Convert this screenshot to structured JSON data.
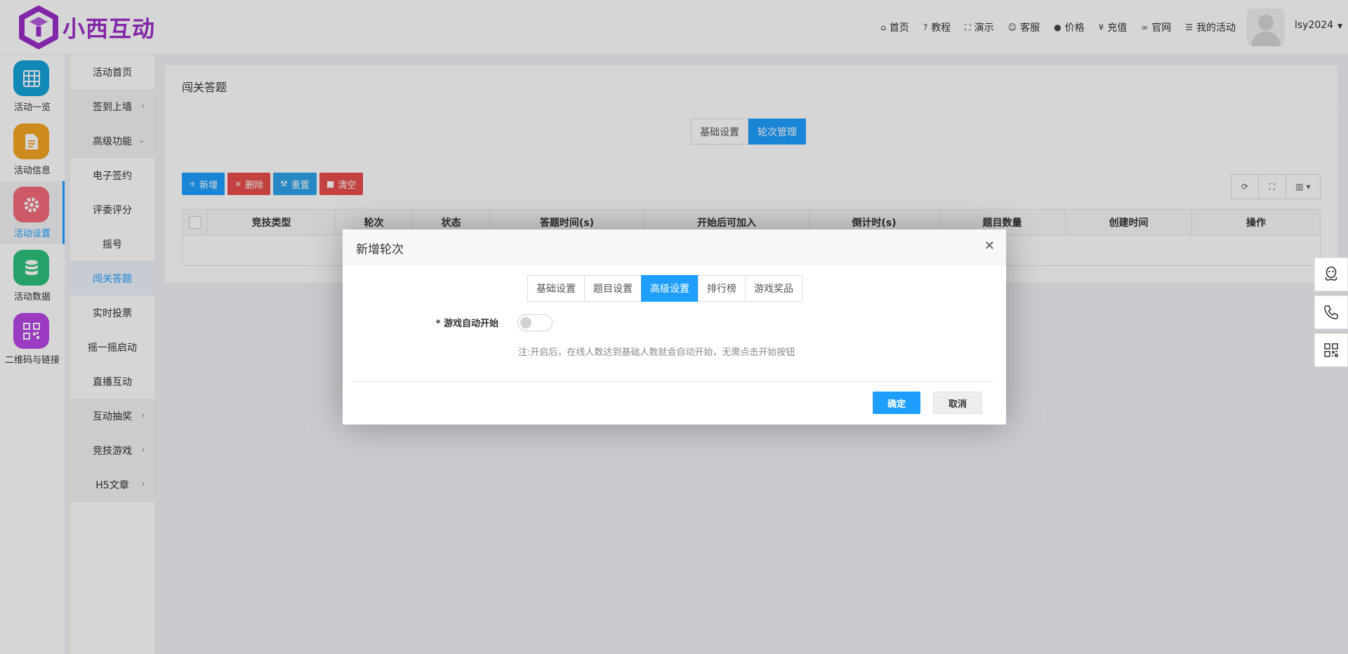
{
  "brand": {
    "name": "小西互动",
    "color": "#9b2ec9"
  },
  "topnav": [
    {
      "label": "首页",
      "icon": "home-icon"
    },
    {
      "label": "教程",
      "icon": "question-icon"
    },
    {
      "label": "演示",
      "icon": "expand-icon"
    },
    {
      "label": "客服",
      "icon": "smile-icon"
    },
    {
      "label": "价格",
      "icon": "info-icon"
    },
    {
      "label": "充值",
      "icon": "yen-icon"
    },
    {
      "label": "官网",
      "icon": "link-icon"
    },
    {
      "label": "我的活动",
      "icon": "list-icon"
    }
  ],
  "user": {
    "name": "lsy2024"
  },
  "rail": [
    {
      "label": "活动一览",
      "icon": "grid-icon",
      "color": "#16a3d9"
    },
    {
      "label": "活动信息",
      "icon": "document-icon",
      "color": "#f5a623"
    },
    {
      "label": "活动设置",
      "icon": "gear-icon",
      "color": "#f26b7a",
      "active": true
    },
    {
      "label": "活动数据",
      "icon": "database-icon",
      "color": "#2ec27e"
    },
    {
      "label": "二维码与链接",
      "icon": "qrcode-icon",
      "color": "#b847e8"
    }
  ],
  "submenu": [
    {
      "label": "活动首页"
    },
    {
      "label": "签到上墙",
      "chevron": "›"
    },
    {
      "label": "高级功能",
      "chevron": "⌄"
    },
    {
      "label": "电子签约"
    },
    {
      "label": "评委评分"
    },
    {
      "label": "摇号"
    },
    {
      "label": "闯关答题",
      "active": true
    },
    {
      "label": "实时投票"
    },
    {
      "label": "摇一摇启动"
    },
    {
      "label": "直播互动"
    },
    {
      "label": "互动抽奖",
      "chevron": "›"
    },
    {
      "label": "竞技游戏",
      "chevron": "›"
    },
    {
      "label": "H5文章",
      "chevron": "›"
    }
  ],
  "card": {
    "title": "闯关答题",
    "tabs": [
      "基础设置",
      "轮次管理"
    ],
    "toolbar": [
      {
        "label": "新增",
        "icon": "+"
      },
      {
        "label": "删除",
        "icon": "×"
      },
      {
        "label": "重置",
        "icon": "⚒"
      },
      {
        "label": "清空",
        "icon": "■"
      }
    ],
    "columns": [
      "竞技类型",
      "轮次",
      "状态",
      "答题时间(s)",
      "开始后可加入",
      "倒计时(s)",
      "题目数量",
      "创建时间",
      "操作"
    ]
  },
  "modal": {
    "title": "新增轮次",
    "tabs": [
      "基础设置",
      "题目设置",
      "高级设置",
      "排行榜",
      "游戏奖品"
    ],
    "field_label": "* 游戏自动开始",
    "hint": "注:开启后，在线人数达到基础人数就会自动开始，无需点击开始按钮",
    "ok": "确定",
    "cancel": "取消"
  }
}
